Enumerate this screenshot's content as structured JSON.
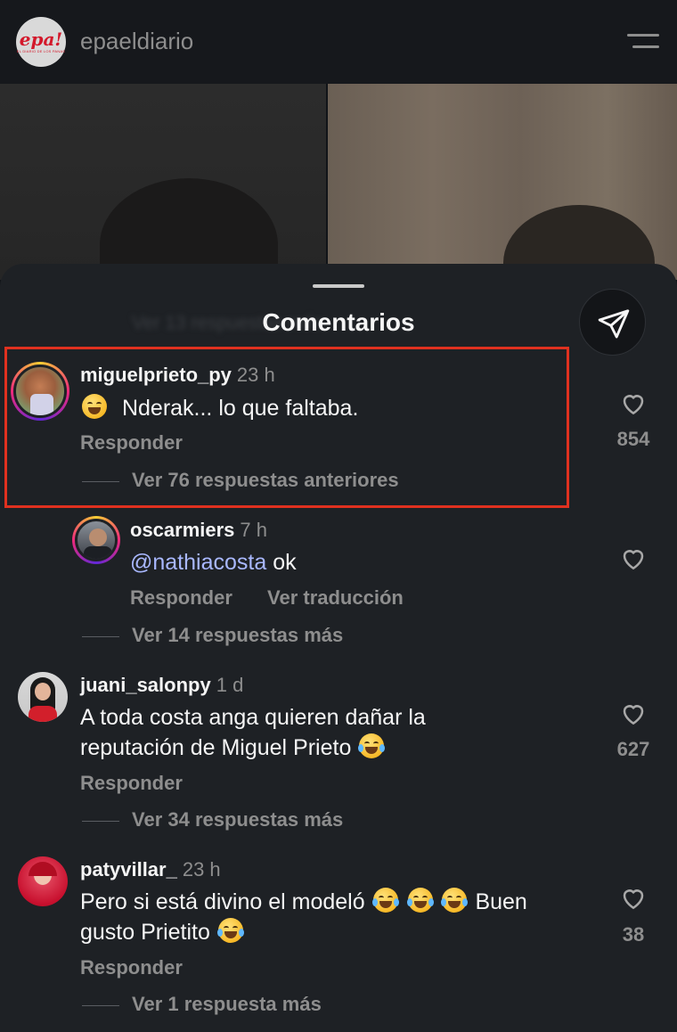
{
  "header": {
    "logo_text": "epa!",
    "logo_sub": "EL DIARIO DE LOS PANAS",
    "account_name": "epaeldiario"
  },
  "sheet": {
    "title": "Comentarios",
    "ghost_text": "Ver 13 respuestas más"
  },
  "comments": [
    {
      "username": "miguelprieto_py",
      "time": "23 h",
      "text": "Nderak... lo que faltaba.",
      "reply_label": "Responder",
      "view_replies": "Ver 76 respuestas anteriores",
      "likes": "854"
    },
    {
      "username": "oscarmiers",
      "time": "7 h",
      "mention": "@nathiacosta",
      "text": "ok",
      "reply_label": "Responder",
      "translate_label": "Ver traducción",
      "view_replies": "Ver 14 respuestas más"
    },
    {
      "username": "juani_salonpy",
      "time": "1 d",
      "text_line1": "A toda costa anga quieren dañar la",
      "text_line2": "reputación de Miguel Prieto",
      "reply_label": "Responder",
      "view_replies": "Ver 34 respuestas más",
      "likes": "627"
    },
    {
      "username": "patyvillar_",
      "time": "23 h",
      "text_line1_a": "Pero si está divino el modeló",
      "text_line1_b": "Buen",
      "text_line2": "gusto Prietito",
      "reply_label": "Responder",
      "view_replies": "Ver 1 respuesta más",
      "likes": "38"
    }
  ]
}
